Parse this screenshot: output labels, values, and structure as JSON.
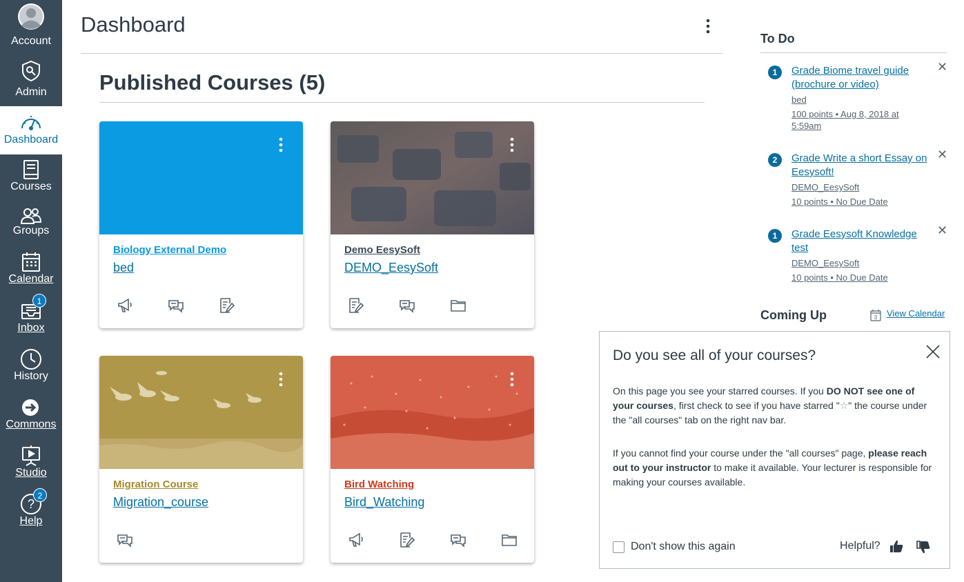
{
  "nav": {
    "account": "Account",
    "admin": "Admin",
    "dashboard": "Dashboard",
    "courses": "Courses",
    "groups": "Groups",
    "calendar": "Calendar",
    "inbox": "Inbox",
    "inbox_badge": "1",
    "history": "History",
    "commons": "Commons",
    "studio": "Studio",
    "help": "Help",
    "help_badge": "2"
  },
  "header": {
    "title": "Dashboard"
  },
  "section": {
    "title": "Published Courses (5)"
  },
  "courses": [
    {
      "title": "Biology External Demo",
      "code": "bed",
      "color": "#0b9be3"
    },
    {
      "title": "Demo EesySoft",
      "code": "DEMO_EesySoft",
      "color": "#394b58"
    },
    {
      "title": "Migration Course",
      "code": "Migration_course",
      "color": "#a58a2c"
    },
    {
      "title": "Bird Watching",
      "code": "Bird_Watching",
      "color": "#d0381c"
    }
  ],
  "todo": {
    "heading": "To Do",
    "items": [
      {
        "count": "1",
        "title": "Grade Biome travel guide (brochure or video)",
        "course": "bed",
        "detail": "100 points • Aug 8, 2018 at 5:59am"
      },
      {
        "count": "2",
        "title": "Grade Write a short Essay on Eesysoft!",
        "course": "DEMO_EesySoft",
        "detail": "10 points • No Due Date"
      },
      {
        "count": "1",
        "title": "Grade Eesysoft Knowledge test",
        "course": "DEMO_EesySoft",
        "detail": "10 points • No Due Date"
      }
    ]
  },
  "coming_up": {
    "heading": "Coming Up",
    "view_calendar": "View Calendar",
    "calendar_day": "3"
  },
  "popup": {
    "title": "Do you see all of your courses?",
    "p1_a": "On this page you see your starred courses. If you ",
    "p1_b": "DO NOT see one of your courses",
    "p1_c": ", first check to see if you have starred \"",
    "p1_d": "\" the course under the \"all courses\" tab on the right nav bar.",
    "p2_a": "If you cannot find your course under the \"all courses\" page, ",
    "p2_b": "please reach out to your instructor",
    "p2_c": " to make it available. Your lecturer is responsible for making your courses available.",
    "dont_show": "Don't show this again",
    "helpful": "Helpful?"
  }
}
